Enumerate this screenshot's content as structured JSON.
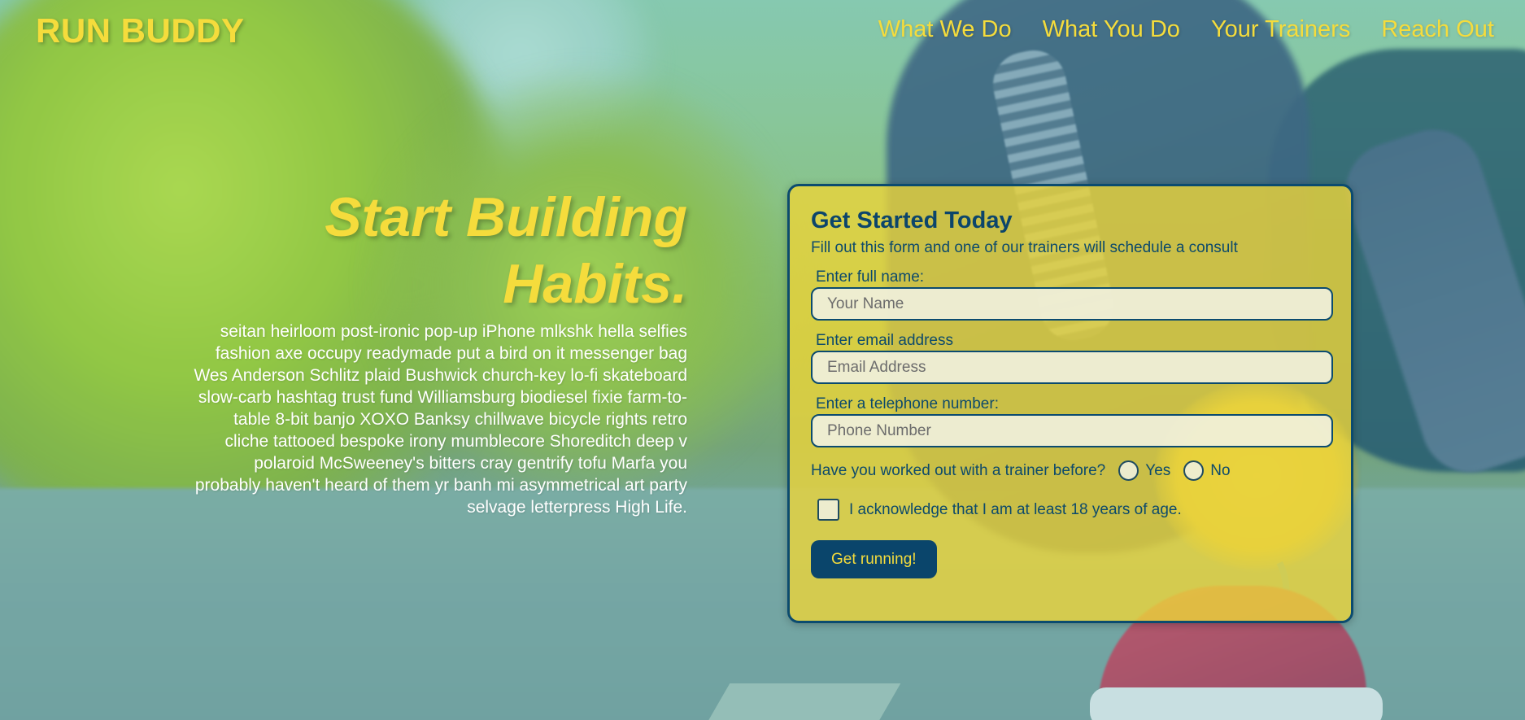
{
  "brand": {
    "name": "RUN BUDDY"
  },
  "nav": {
    "items": [
      "What We Do",
      "What You Do",
      "Your Trainers",
      "Reach Out"
    ]
  },
  "hero": {
    "title_line1": "Start Building",
    "title_line2": "Habits.",
    "text": "seitan heirloom post-ironic pop-up iPhone mlkshk hella selfies fashion axe occupy readymade put a bird on it messenger bag Wes Anderson Schlitz plaid Bushwick church-key lo-fi skateboard slow-carb hashtag trust fund Williamsburg biodiesel fixie farm-to-table 8-bit banjo XOXO Banksy chillwave bicycle rights retro cliche tattooed bespoke irony mumblecore Shoreditch deep v polaroid McSweeney's bitters cray gentrify tofu Marfa you probably haven't heard of them yr banh mi asymmetrical art party selvage letterpress High Life."
  },
  "form": {
    "title": "Get Started Today",
    "subtitle": "Fill out this form and one of our trainers will schedule a consult",
    "name": {
      "label": "Enter full name:",
      "placeholder": "Your Name",
      "value": ""
    },
    "email": {
      "label": "Enter email address",
      "placeholder": "Email Address",
      "value": ""
    },
    "phone": {
      "label": "Enter a telephone number:",
      "placeholder": "Phone Number",
      "value": ""
    },
    "trainer_question": "Have you worked out with a trainer before?",
    "radio_yes": "Yes",
    "radio_no": "No",
    "acknowledge": "I acknowledge that I am at least 18 years of age.",
    "submit": "Get running!"
  },
  "colors": {
    "accent_yellow": "#f5dc3c",
    "navy": "#0a456b"
  }
}
